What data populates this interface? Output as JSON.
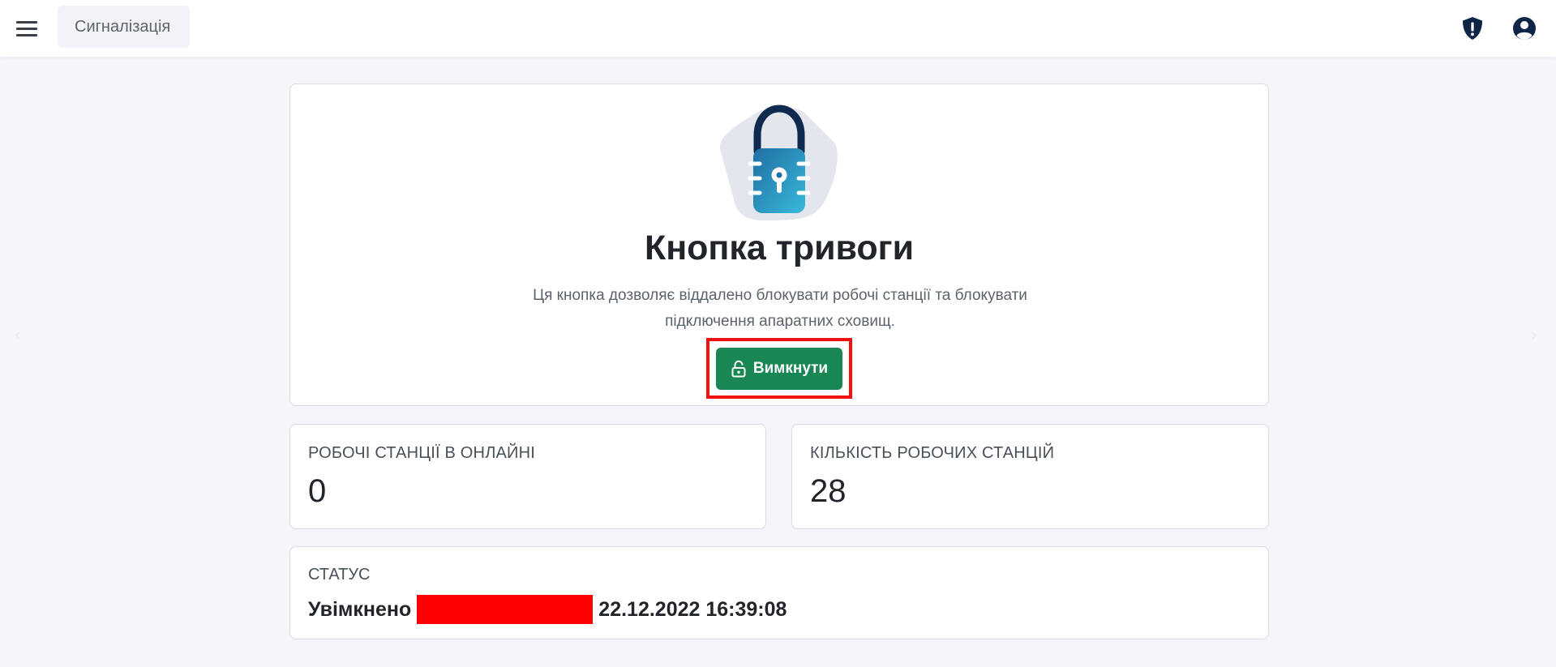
{
  "header": {
    "breadcrumb": "Сигналізація",
    "menu_icon": "hamburger-menu-icon",
    "alert_icon": "shield-exclamation-icon",
    "account_icon": "user-circle-icon"
  },
  "hero": {
    "illustration": "padlock-icon",
    "title": "Кнопка тривоги",
    "description": "Ця кнопка дозволяє віддалено блокувати робочі станції та блокувати підключення апаратних сховищ.",
    "button_label": "Вимкнути",
    "button_icon": "unlock-icon",
    "button_color": "#198754"
  },
  "stats": [
    {
      "label": "РОБОЧІ СТАНЦІЇ В ОНЛАЙНІ",
      "value": "0"
    },
    {
      "label": "КІЛЬКІСТЬ РОБОЧИХ СТАНЦІЙ",
      "value": "28"
    }
  ],
  "status": {
    "label": "СТАТУС",
    "state": "Увімкнено",
    "timestamp": "22.12.2022 16:39:08"
  },
  "carousel": {
    "prev_icon": "chevron-left-icon",
    "next_icon": "chevron-right-icon"
  }
}
